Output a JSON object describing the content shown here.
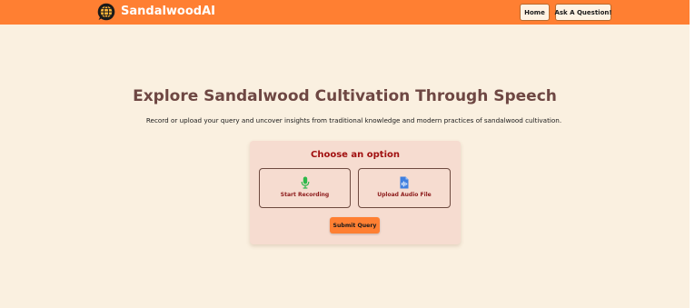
{
  "navbar": {
    "brand": "SandalwoodAI",
    "logo_icon": "chat-globe-icon",
    "links": [
      "Home",
      "Ask A Question!"
    ]
  },
  "hero": {
    "title": "Explore Sandalwood Cultivation Through Speech",
    "subtitle": "Record or upload your query and uncover insights from traditional knowledge and modern practices of sandalwood cultivation."
  },
  "card": {
    "title": "Choose an option",
    "options": [
      {
        "label": "Start Recording",
        "icon": "microphone-icon"
      },
      {
        "label": "Upload Audio File",
        "icon": "audio-file-icon"
      }
    ],
    "submit_label": "Submit Query"
  },
  "colors": {
    "navbar": "#ff7f32",
    "background": "#faf0e0",
    "card": "#f6dcd0",
    "title": "#6e4743",
    "card_title": "#a11010",
    "mic": "#2db84a",
    "file": "#3f7fe0"
  }
}
